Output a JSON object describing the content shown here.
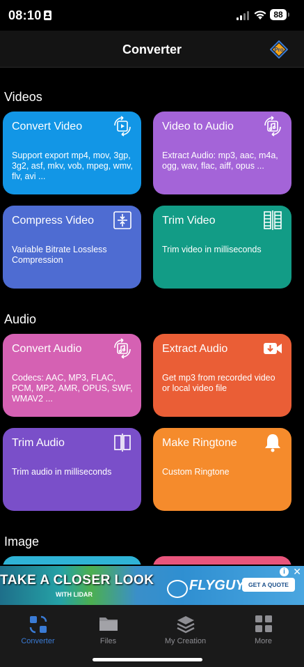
{
  "status": {
    "time": "08:10",
    "battery": "88"
  },
  "nav": {
    "title": "Converter",
    "pro_label": "Pro"
  },
  "sections": {
    "videos": "Videos",
    "audio": "Audio",
    "image": "Image"
  },
  "cards": {
    "convert_video": {
      "title": "Convert Video",
      "desc": "Support export mp4, mov, 3gp, 3g2, asf, mkv, vob, mpeg, wmv, flv, avi ...",
      "color": "#1296e6"
    },
    "video_to_audio": {
      "title": "Video to Audio",
      "desc": "Extract Audio: mp3, aac, m4a, ogg, wav, flac, aiff, opus ...",
      "color": "#a464d8"
    },
    "compress_video": {
      "title": "Compress Video",
      "desc": "Variable Bitrate Lossless Compression",
      "color": "#4e6cd2"
    },
    "trim_video": {
      "title": "Trim Video",
      "desc": "Trim video in milliseconds",
      "color": "#129c86"
    },
    "convert_audio": {
      "title": "Convert Audio",
      "desc": "Codecs: AAC, MP3, FLAC, PCM, MP2, AMR, OPUS, SWF, WMAV2 ...",
      "color": "#d561b3"
    },
    "extract_audio": {
      "title": "Extract Audio",
      "desc": "Get mp3 from recorded video or local video file",
      "color": "#ea5e36"
    },
    "trim_audio": {
      "title": "Trim Audio",
      "desc": "Trim audio in milliseconds",
      "color": "#7a4fc9"
    },
    "make_ringtone": {
      "title": "Make Ringtone",
      "desc": "Custom Ringtone",
      "color": "#f58b2c"
    }
  },
  "ad": {
    "headline": "TAKE A CLOSER LOOK",
    "subline": "WITH LIDAR",
    "brand": "FLYGUYS",
    "cta": "GET A QUOTE"
  },
  "tabs": [
    {
      "label": "Converter",
      "icon": "converter-icon",
      "active": true
    },
    {
      "label": "Files",
      "icon": "folder-icon",
      "active": false
    },
    {
      "label": "My Creation",
      "icon": "layers-icon",
      "active": false
    },
    {
      "label": "More",
      "icon": "grid-icon",
      "active": false
    }
  ]
}
